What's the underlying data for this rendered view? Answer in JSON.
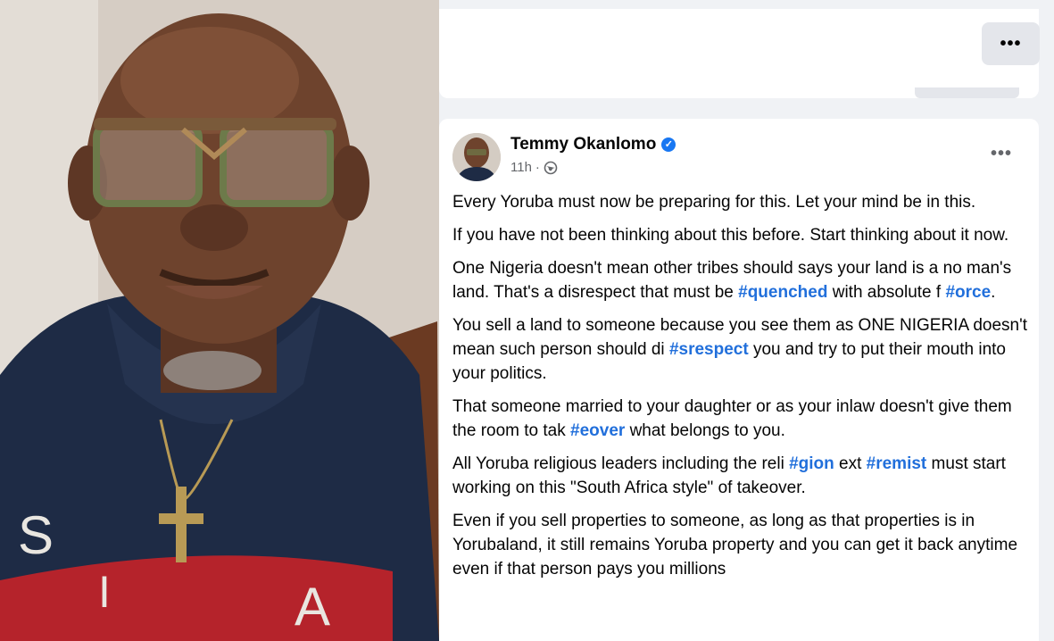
{
  "photo": {
    "alt_subject": "portrait-photo"
  },
  "header": {
    "more_label": "•••"
  },
  "post": {
    "author": "Temmy Okanlomo",
    "verified_icon": "verified-badge-icon",
    "time": "11h",
    "time_separator": "·",
    "privacy_icon": "globe-icon",
    "more_label": "•••",
    "paragraphs": [
      {
        "parts": [
          {
            "text": "Every Yoruba must now be preparing for this. Let your mind be in this."
          }
        ]
      },
      {
        "parts": [
          {
            "text": "If you have not been thinking about this before. Start thinking about it now."
          }
        ]
      },
      {
        "parts": [
          {
            "text": "One Nigeria doesn't mean other tribes should says your land is a no man's land. That's a disrespect that must be "
          },
          {
            "tag": "#quenched"
          },
          {
            "text": " with absolute f "
          },
          {
            "tag": "#orce"
          },
          {
            "text": "."
          }
        ]
      },
      {
        "parts": [
          {
            "text": "You sell a land to someone because you see them as ONE NIGERIA doesn't mean such person should di "
          },
          {
            "tag": "#srespect"
          },
          {
            "text": " you and try to put their mouth into your politics."
          }
        ]
      },
      {
        "parts": [
          {
            "text": "That someone married to your daughter or as your inlaw doesn't give them the room to tak "
          },
          {
            "tag": "#eover"
          },
          {
            "text": " what belongs to you."
          }
        ]
      },
      {
        "parts": [
          {
            "text": "All Yoruba religious leaders including the reli "
          },
          {
            "tag": "#gion"
          },
          {
            "text": " ext "
          },
          {
            "tag": "#remist"
          },
          {
            "text": " must start working on this \"South Africa style\" of takeover."
          }
        ]
      },
      {
        "parts": [
          {
            "text": "Even if you sell properties to someone, as long as that properties is in Yorubaland, it still remains Yoruba property and you can get it back anytime even if that person pays you millions"
          }
        ]
      }
    ]
  },
  "colors": {
    "hashtag": "#216fdb",
    "verified": "#1877f2",
    "feed_bg": "#f0f2f5"
  }
}
